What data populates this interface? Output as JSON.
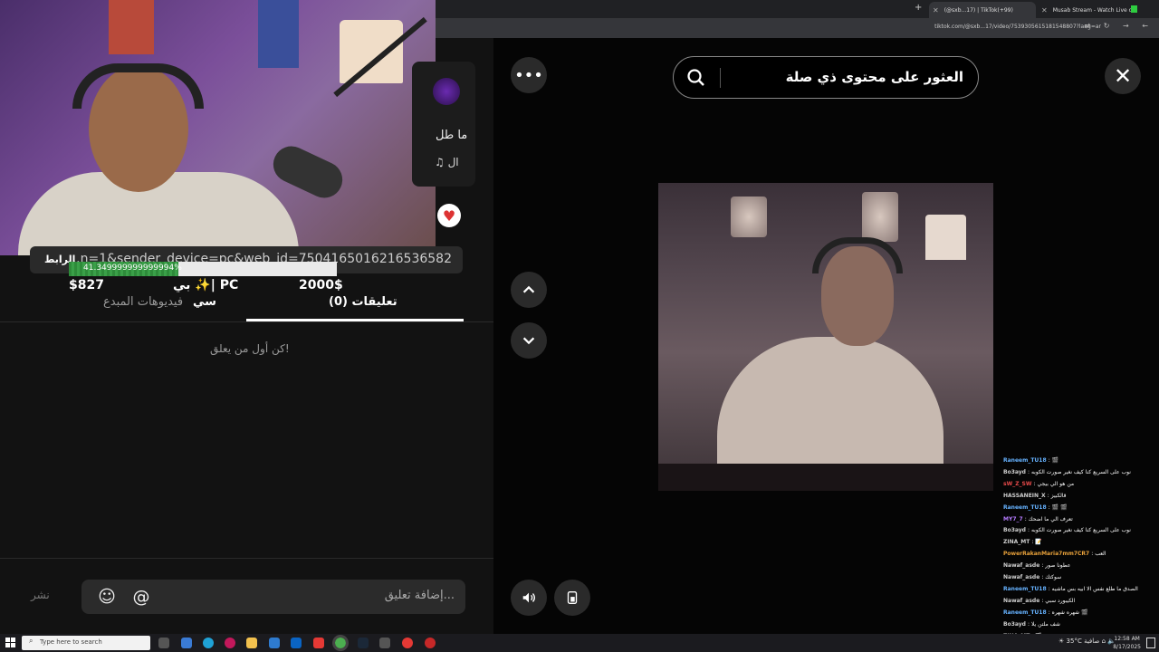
{
  "browser": {
    "tabs": [
      {
        "label": "(@sxb...17) | TikTok(+99)",
        "active": true
      },
      {
        "label": "Musab Stream - Watch Live on",
        "active": false
      }
    ],
    "url": "tiktok.com/@sxb...17/video/7539305615181548807?lang=ar"
  },
  "search": {
    "placeholder": "العثور على محتوى ذي صلة"
  },
  "video_card": {
    "text": "ما طل",
    "music_symbol": "♫ ال"
  },
  "link_row": {
    "label": "الرابط",
    "value": "...n=1&sender_device=pc&web_id=7504165016216536582"
  },
  "overlay_progress": {
    "fraction": 0.41,
    "label": "41.349999999999994%"
  },
  "stats": {
    "left_value": "$827",
    "middle": "بي ✨| PC",
    "right_value": "2000$"
  },
  "tabs": {
    "comments": "(0) تعليقات",
    "creator_videos": "فيديوهات المبدع",
    "extra": "سي"
  },
  "comments": {
    "empty": "كن أول من يعلق!",
    "placeholder": "إضافة تعليق...",
    "post": "نشر"
  },
  "chat": [
    {
      "user": "Raneem_TU18",
      "msg": ": 🎬",
      "color": "#66b2ff"
    },
    {
      "user": "Bo3ayd",
      "msg": ": نوب على السريع كنا كيف نغير صورت الكوبه",
      "color": "#cfcfcf"
    },
    {
      "user": "sW_Z_SW",
      "msg": ": من هو الي بيجي",
      "color": "#e84a4a"
    },
    {
      "user": "HASSANEIN_X",
      "msg": ": قالكبيز",
      "color": "#cfcfcf"
    },
    {
      "user": "Raneem_TU18",
      "msg": ": 🎬 🎬",
      "color": "#66b2ff"
    },
    {
      "user": "MY7_7",
      "msg": ": تعرف الي ما اضحك",
      "color": "#b57cff"
    },
    {
      "user": "Bo3ayd",
      "msg": ": نوب على السريع كنا كيف نغير صورت الكوبه",
      "color": "#cfcfcf"
    },
    {
      "user": "ZINA_MT",
      "msg": ": 📝",
      "color": "#cfcfcf"
    },
    {
      "user": "PowerRakanMaria7mm7CR7",
      "msg": ": العب",
      "color": "#e8a13a"
    },
    {
      "user": "Nawaf_asde",
      "msg": ": عطونا صور",
      "color": "#cfcfcf"
    },
    {
      "user": "Nawaf_asde",
      "msg": ": سوكتك",
      "color": "#cfcfcf"
    },
    {
      "user": "Raneem_TU18",
      "msg": ": الصدق ما طلع نفس الا ابيه بس ماشيه",
      "color": "#66b2ff"
    },
    {
      "user": "Nawaf_asde",
      "msg": ": الكيبورد سبي",
      "color": "#cfcfcf"
    },
    {
      "user": "Raneem_TU18",
      "msg": ": شهره شهره 🎬",
      "color": "#66b2ff"
    },
    {
      "user": "Bo3ayd",
      "msg": ": شف ملتن يلا",
      "color": "#cfcfcf"
    },
    {
      "user": "ZINA_MT",
      "msg": ": 🎬",
      "color": "#cfcfcf"
    }
  ],
  "taskbar": {
    "search_placeholder": "Type here to search",
    "weather": "35°C صافية",
    "time": "12:58 AM",
    "date": "8/17/2025"
  }
}
